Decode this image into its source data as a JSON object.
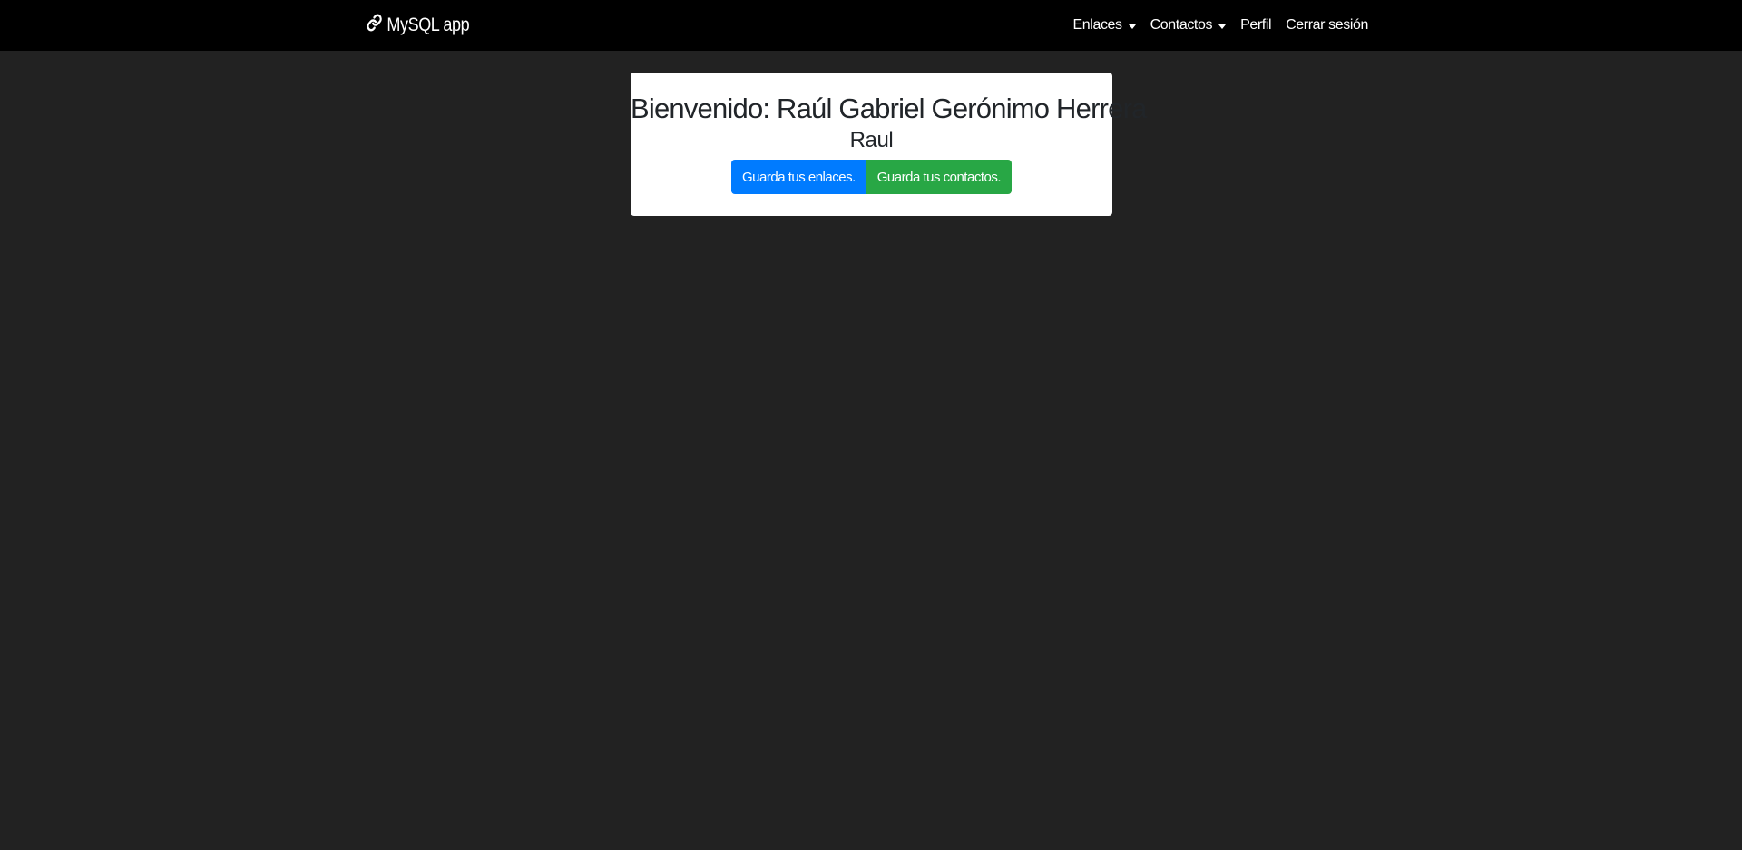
{
  "navbar": {
    "brand_label": "MySQL app",
    "brand_icon": "link-icon",
    "items": [
      {
        "label": "Enlaces",
        "dropdown": true
      },
      {
        "label": "Contactos",
        "dropdown": true
      },
      {
        "label": "Perfil",
        "dropdown": false
      },
      {
        "label": "Cerrar sesión",
        "dropdown": false
      }
    ]
  },
  "card": {
    "welcome_text": "Bienvenido: Raúl Gabriel Gerónimo Herrera",
    "username": "Raul",
    "buttons": {
      "links_label": "Guarda tus enlaces.",
      "contacts_label": "Guarda tus contactos."
    }
  },
  "colors": {
    "background": "#222222",
    "navbar": "#000000",
    "primary": "#007bff",
    "success": "#28a745",
    "card": "#ffffff"
  }
}
